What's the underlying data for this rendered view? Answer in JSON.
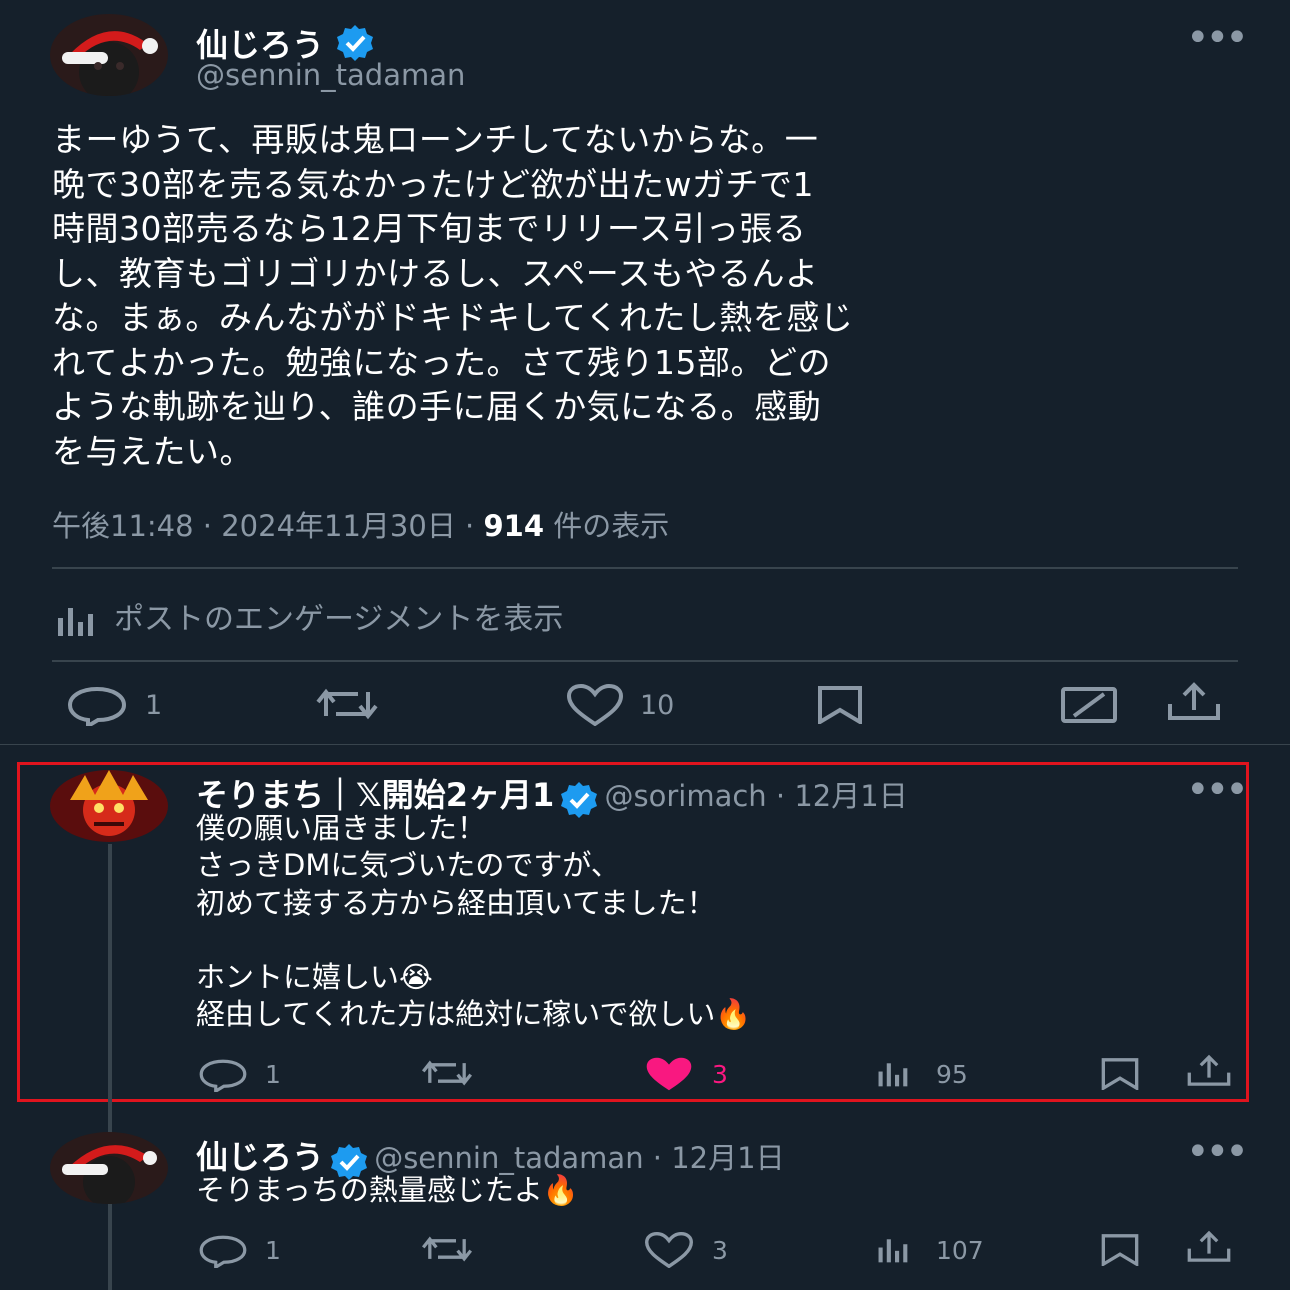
{
  "main_post": {
    "display_name": "仙じろう",
    "handle": "@sennin_tadaman",
    "body": "まーゆうて、再販は鬼ローンチしてないからな。一\n晩で30部を売る気なかったけど欲が出たwガチで1\n時間30部売るなら12月下旬までリリース引っ張る\nし、教育もゴリゴリかけるし、スペースもやるんよ\nな。まぁ。みんなががドキドキしてくれたし熱を感じ\nれてよかった。勉強になった。さて残り15部。どの\nような軌跡を辿り、誰の手に届くか気になる。感動\nを与えたい。",
    "time": "午後11:48 · 2024年11月30日 · ",
    "views_count": "914",
    "views_label": " 件の表示",
    "engagement_link": "ポストのエンゲージメントを表示",
    "reply_count": "1",
    "like_count": "10"
  },
  "reply_1": {
    "display_name": "そりまち｜𝕏開始2ヶ月1",
    "handle": "@sorimach",
    "date": " · 12月1日",
    "body": "僕の願い届きました！\nさっきDMに気づいたのですが、\n初めて接する方から経由頂いてました！\n\nホントに嬉しい😭\n経由してくれた方は絶対に稼いで欲しい🔥",
    "reply_count": "1",
    "like_count": "3",
    "view_count": "95"
  },
  "reply_2": {
    "display_name": "仙じろう",
    "handle": "@sennin_tadaman",
    "date": " · 12月1日",
    "body": "そりまっちの熱量感じたよ🔥",
    "reply_count": "1",
    "like_count": "3",
    "view_count": "107"
  },
  "colors": {
    "background": "#15202b",
    "muted": "#8b98a5",
    "verified": "#1d9bf0",
    "like_active": "#f91880",
    "highlight_border": "#e0141e"
  },
  "icons": [
    "more-icon",
    "verified-icon",
    "reply-icon",
    "repost-icon",
    "like-icon",
    "bookmark-icon",
    "share-icon",
    "grok-icon",
    "analytics-icon"
  ]
}
